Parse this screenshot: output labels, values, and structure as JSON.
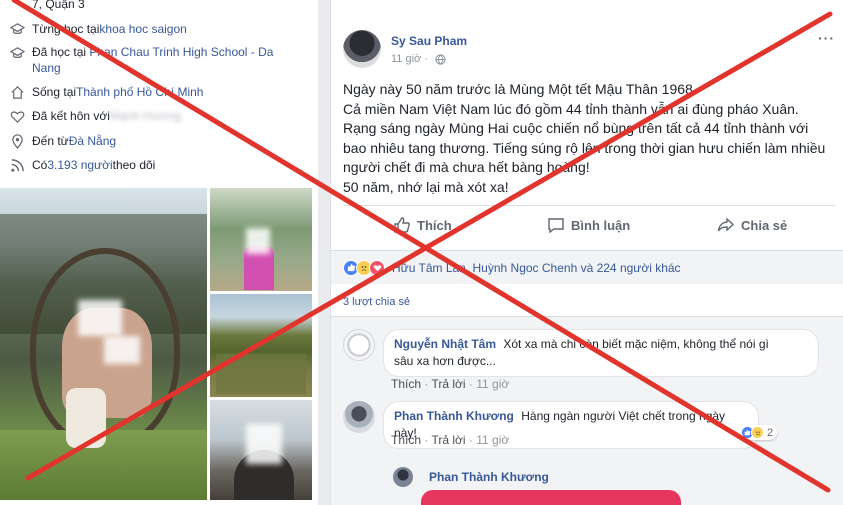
{
  "profile": {
    "address_partial": "7, Quận 3",
    "intro": [
      {
        "icon": "graduation-cap-icon",
        "prefix": "Từng học tại ",
        "link": "khoa hoc saigon"
      },
      {
        "icon": "graduation-cap-icon",
        "prefix": "Đã học tại ",
        "link": "Phan Chau Trinh High School - Da Nang"
      },
      {
        "icon": "home-icon",
        "prefix": "Sống tại ",
        "link": "Thành phố Hồ Chí Minh"
      },
      {
        "icon": "heart-icon",
        "prefix": "Đã kết hôn với ",
        "link": "Mạnh Hương"
      },
      {
        "icon": "location-pin-icon",
        "prefix": "Đến từ ",
        "link": "Đà Nẵng"
      },
      {
        "icon": "rss-icon",
        "prefix": "Có ",
        "link": "3.193 người",
        "suffix": " theo dõi"
      }
    ]
  },
  "post": {
    "author": "Sy Sau Pham",
    "time": "11 giờ",
    "more": "···",
    "lines": [
      "Ngày này 50 năm trước là Mùng Một tết Mậu Thân 1968.",
      "Cả miền Nam Việt Nam lúc đó gồm 44 tỉnh thành vẫn ai đùng pháo Xuân.",
      "Rạng sáng ngày Mùng Hai cuộc chiến nổ bùng trên tất cả 44 tỉnh thành với",
      "bao nhiêu tang thương. Tiếng súng rộ lên trong thời gian hưu chiến làm nhiều",
      "người chết đi mà chưa hết bàng hoàng!",
      "50 năm, nhớ lại mà xót xa!"
    ],
    "actions": {
      "like": "Thích",
      "comment": "Bình luận",
      "share": "Chia sẻ"
    },
    "reactions_text": "Hữu Tâm Lan, Huỳnh Ngoc Chenh và 224 người khác",
    "shares": "3 lượt chia sẻ"
  },
  "comments": [
    {
      "name": "Nguyễn Nhật Tâm",
      "text1": "Xót xa mà chỉ còn biết mặc niệm, không thể nói gì",
      "text2": "sâu xa hơn được...",
      "like": "Thích",
      "reply": "Trả lời",
      "time": "11 giờ"
    },
    {
      "name": "Phan Thành Khương",
      "text1": "Hàng ngàn người Việt chết trong ngày này!",
      "like": "Thích",
      "reply": "Trả lời",
      "time": "11 giờ",
      "reaction_count": "2"
    }
  ],
  "reply": {
    "name": "Phan Thành Khương"
  },
  "colors": {
    "link": "#365899",
    "cross": "#e0342c",
    "meta": "#90949c"
  }
}
